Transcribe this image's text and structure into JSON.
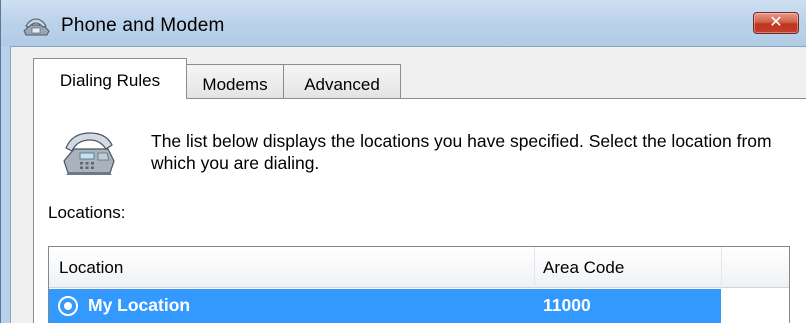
{
  "window": {
    "title": "Phone and Modem",
    "close_label": "✕"
  },
  "tabs": [
    {
      "label": "Dialing Rules",
      "active": true
    },
    {
      "label": "Modems",
      "active": false
    },
    {
      "label": "Advanced",
      "active": false
    }
  ],
  "dialing_rules": {
    "description": "The list below displays the locations you have specified. Select the location from which you are dialing.",
    "locations_label": "Locations:",
    "columns": {
      "location": "Location",
      "area_code": "Area Code"
    },
    "rows": [
      {
        "location": "My Location",
        "area_code": "11000",
        "selected": true
      }
    ]
  },
  "colors": {
    "selection": "#3399ff",
    "title_bar": "#bcd3ea",
    "close_button": "#c7432d"
  },
  "icons": {
    "title": "telephone-modem-icon",
    "panel": "telephone-icon",
    "row": "radio-selected-icon"
  }
}
